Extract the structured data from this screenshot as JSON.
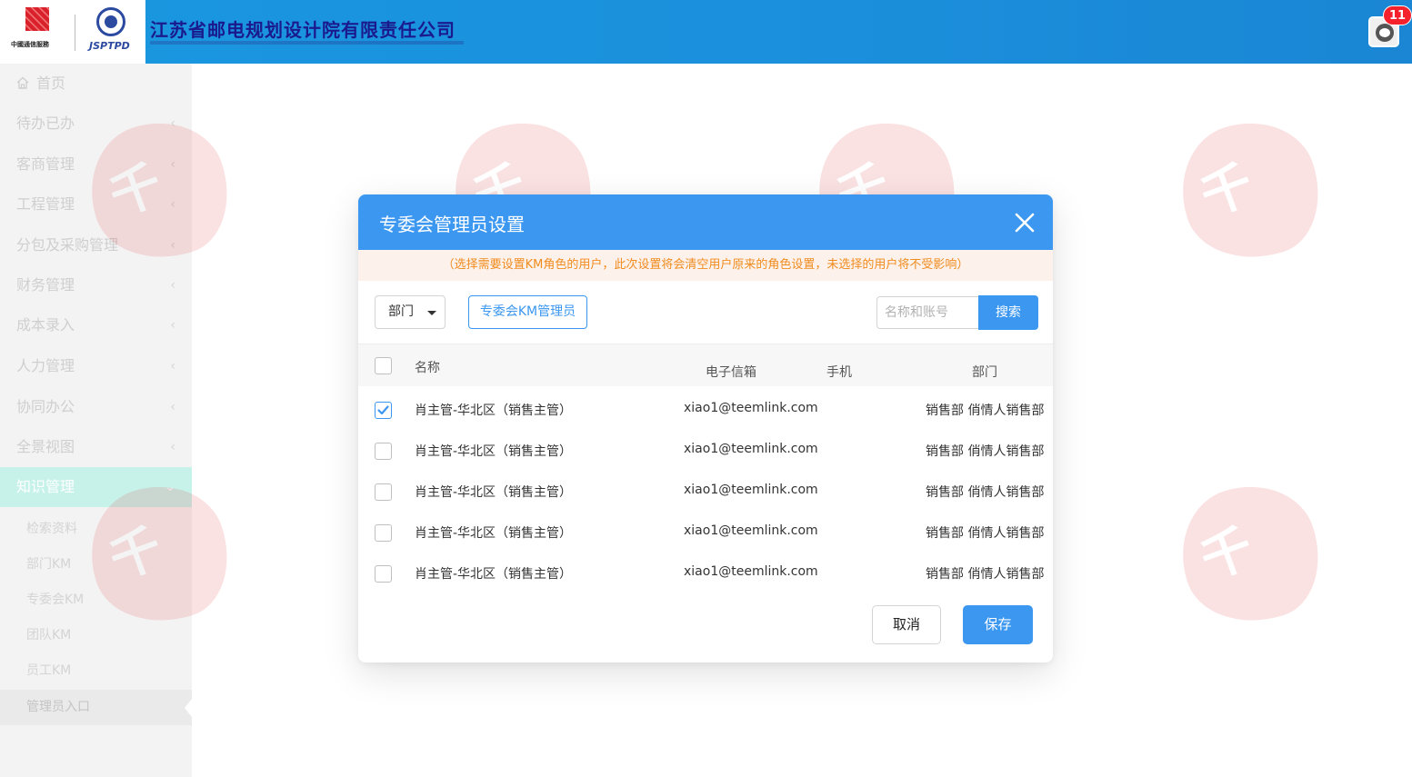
{
  "header": {
    "company_name": "江苏省邮电规划设计院有限责任公司",
    "logo_left_caption": "中國通信服務",
    "logo_right_caption": "JSPTPD",
    "notification_count": "11"
  },
  "sidebar": {
    "items": [
      {
        "label": "首页",
        "icon": "home-icon"
      },
      {
        "label": "待办已办",
        "chevron": "‹"
      },
      {
        "label": "客商管理",
        "chevron": "‹"
      },
      {
        "label": "工程管理",
        "chevron": "‹"
      },
      {
        "label": "分包及采购管理",
        "chevron": "‹"
      },
      {
        "label": "财务管理",
        "chevron": "‹"
      },
      {
        "label": "成本录入",
        "chevron": "‹"
      },
      {
        "label": "人力管理",
        "chevron": "‹"
      },
      {
        "label": "协同办公",
        "chevron": "‹"
      },
      {
        "label": "全景视图",
        "chevron": "‹"
      },
      {
        "label": "知识管理",
        "chevron": "⌄"
      }
    ],
    "sub_items": [
      {
        "label": "检索资料"
      },
      {
        "label": "部门KM"
      },
      {
        "label": "专委会KM"
      },
      {
        "label": "团队KM"
      },
      {
        "label": "员工KM"
      },
      {
        "label": "管理员入口"
      }
    ]
  },
  "dialog": {
    "title": "专委会管理员设置",
    "notice": "（选择需要设置KM角色的用户，此次设置将会清空用户原来的角色设置，未选择的用户将不受影响）",
    "dept_select": "部门",
    "km_admin_button": "专委会KM管理员",
    "search_placeholder": "名称和账号",
    "search_button": "搜索",
    "columns": {
      "name": "名称",
      "email": "电子信箱",
      "phone": "手机",
      "dept": "部门"
    },
    "rows": [
      {
        "name": "肖主管-华北区（销售主管）",
        "email": "xiao1@teemlink.com",
        "phone": "",
        "dept": "销售部 俏情人销售部",
        "checked": true
      },
      {
        "name": "肖主管-华北区（销售主管）",
        "email": "xiao1@teemlink.com",
        "phone": "",
        "dept": "销售部 俏情人销售部",
        "checked": false
      },
      {
        "name": "肖主管-华北区（销售主管）",
        "email": "xiao1@teemlink.com",
        "phone": "",
        "dept": "销售部 俏情人销售部",
        "checked": false
      },
      {
        "name": "肖主管-华北区（销售主管）",
        "email": "xiao1@teemlink.com",
        "phone": "",
        "dept": "销售部 俏情人销售部",
        "checked": false
      },
      {
        "name": "肖主管-华北区（销售主管）",
        "email": "xiao1@teemlink.com",
        "phone": "",
        "dept": "销售部 俏情人销售部",
        "checked": false
      }
    ],
    "cancel_button": "取消",
    "save_button": "保存"
  },
  "colors": {
    "header_blue": "#1a97e0",
    "dialog_blue": "#3b97f0",
    "notice_orange": "#f08c1e",
    "notice_bg": "#fdf1ec",
    "active_menu": "#c7f2ea",
    "badge_red": "#f5222d"
  }
}
